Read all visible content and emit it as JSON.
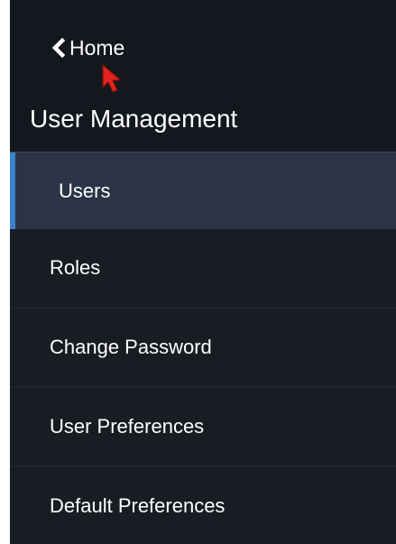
{
  "header": {
    "home_label": "Home",
    "section_title": "User Management"
  },
  "nav": {
    "items": [
      {
        "label": "Users",
        "active": true
      },
      {
        "label": "Roles",
        "active": false
      },
      {
        "label": "Change Password",
        "active": false
      },
      {
        "label": "User Preferences",
        "active": false
      },
      {
        "label": "Default Preferences",
        "active": false
      }
    ]
  },
  "colors": {
    "sidebar_bg": "#181c23",
    "header_bg": "#14181e",
    "active_bg": "#2a3445",
    "accent": "#3a83c9",
    "text": "#ffffff",
    "cursor": "#e0241e"
  },
  "icons": {
    "back": "chevron-left-icon",
    "pointer": "mouse-pointer-icon"
  }
}
